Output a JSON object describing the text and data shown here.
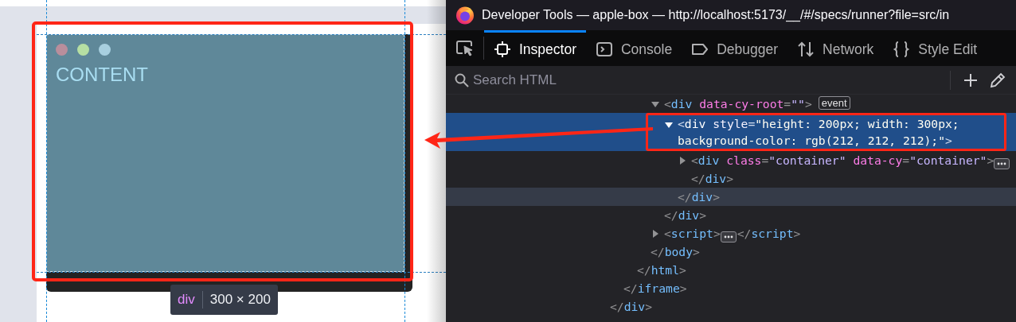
{
  "preview": {
    "dots": [
      {
        "color": "#b98e9c"
      },
      {
        "color": "#b6dfa3"
      },
      {
        "color": "#a8cfdf"
      }
    ],
    "content": "CONTENT",
    "tooltip": {
      "tag": "div",
      "size": "300 × 200"
    }
  },
  "devtools": {
    "title": "Developer Tools — apple-box — http://localhost:5173/__/#/specs/runner?file=src/in",
    "tabs": [
      {
        "label": "Inspector",
        "selected": true
      },
      {
        "label": "Console",
        "selected": false
      },
      {
        "label": "Debugger",
        "selected": false
      },
      {
        "label": "Network",
        "selected": false
      },
      {
        "label": "Style Edit",
        "selected": false
      }
    ],
    "search": {
      "placeholder": "Search HTML"
    },
    "markup": [
      {
        "close": [
          {
            "kind": "punct",
            "text": "</"
          },
          {
            "kind": "tag",
            "text": "div"
          },
          {
            "kind": "punct",
            "text": ">"
          }
        ],
        "children": [
          {
            "close": [
              {
                "kind": "punct",
                "text": "</"
              },
              {
                "kind": "tag",
                "text": "iframe"
              },
              {
                "kind": "punct",
                "text": ">"
              }
            ],
            "children": [
              {
                "close": [
                  {
                    "kind": "punct",
                    "text": "</"
                  },
                  {
                    "kind": "tag",
                    "text": "html"
                  },
                  {
                    "kind": "punct",
                    "text": ">"
                  }
                ],
                "children": [
                  {
                    "close": [
                      {
                        "kind": "punct",
                        "text": "</"
                      },
                      {
                        "kind": "tag",
                        "text": "body"
                      },
                      {
                        "kind": "punct",
                        "text": ">"
                      }
                    ],
                    "children": [
                      {
                        "open": [
                          {
                            "kind": "punct",
                            "text": "<"
                          },
                          {
                            "kind": "tag",
                            "text": "div"
                          },
                          {
                            "kind": "attr",
                            "text": " data-cy-root"
                          },
                          {
                            "kind": "punct",
                            "text": "="
                          },
                          {
                            "kind": "value",
                            "text": "\"\""
                          },
                          {
                            "kind": "punct",
                            "text": ">"
                          },
                          {
                            "kind": "badge",
                            "text": "event"
                          }
                        ],
                        "expanded": true,
                        "selected": false,
                        "close": [
                          {
                            "kind": "punct",
                            "text": "</"
                          },
                          {
                            "kind": "tag",
                            "text": "div"
                          },
                          {
                            "kind": "punct",
                            "text": ">"
                          }
                        ],
                        "children": [
                          {
                            "open": [
                              {
                                "kind": "punct",
                                "text": "<"
                              },
                              {
                                "kind": "tag",
                                "text": "div"
                              },
                              {
                                "kind": "attr",
                                "text": " style"
                              },
                              {
                                "kind": "punct",
                                "text": "="
                              },
                              {
                                "kind": "value",
                                "text": "\"height: 200px; width: 300px; background-color: rgb(212, 212, 212);\""
                              },
                              {
                                "kind": "punct",
                                "text": ">"
                              }
                            ],
                            "expanded": true,
                            "selected": true,
                            "close": [
                              {
                                "kind": "punct",
                                "text": "</"
                              },
                              {
                                "kind": "tag",
                                "text": "div"
                              },
                              {
                                "kind": "punct",
                                "text": ">"
                              }
                            ],
                            "close_highlighted": true,
                            "children": [
                              {
                                "open": [
                                  {
                                    "kind": "punct",
                                    "text": "<"
                                  },
                                  {
                                    "kind": "tag",
                                    "text": "div"
                                  },
                                  {
                                    "kind": "attr",
                                    "text": " class"
                                  },
                                  {
                                    "kind": "punct",
                                    "text": "="
                                  },
                                  {
                                    "kind": "value",
                                    "text": "\"container\""
                                  },
                                  {
                                    "kind": "attr",
                                    "text": " data-cy"
                                  },
                                  {
                                    "kind": "punct",
                                    "text": "="
                                  },
                                  {
                                    "kind": "value",
                                    "text": "\"container\""
                                  },
                                  {
                                    "kind": "punct",
                                    "text": ">"
                                  },
                                  {
                                    "kind": "ellipsis"
                                  },
                                  {
                                    "kind": "punct",
                                    "text": "</"
                                  },
                                  {
                                    "kind": "tag",
                                    "text": "div"
                                  },
                                  {
                                    "kind": "punct",
                                    "text": ">"
                                  }
                                ],
                                "expanded": false,
                                "selected": false
                              }
                            ]
                          }
                        ]
                      },
                      {
                        "open": [
                          {
                            "kind": "punct",
                            "text": "<"
                          },
                          {
                            "kind": "tag",
                            "text": "script"
                          },
                          {
                            "kind": "punct",
                            "text": ">"
                          },
                          {
                            "kind": "ellipsis"
                          },
                          {
                            "kind": "punct",
                            "text": "</"
                          },
                          {
                            "kind": "tag",
                            "text": "script"
                          },
                          {
                            "kind": "punct",
                            "text": ">"
                          }
                        ],
                        "expanded": false,
                        "selected": false
                      }
                    ]
                  }
                ]
              }
            ]
          }
        ]
      }
    ]
  }
}
